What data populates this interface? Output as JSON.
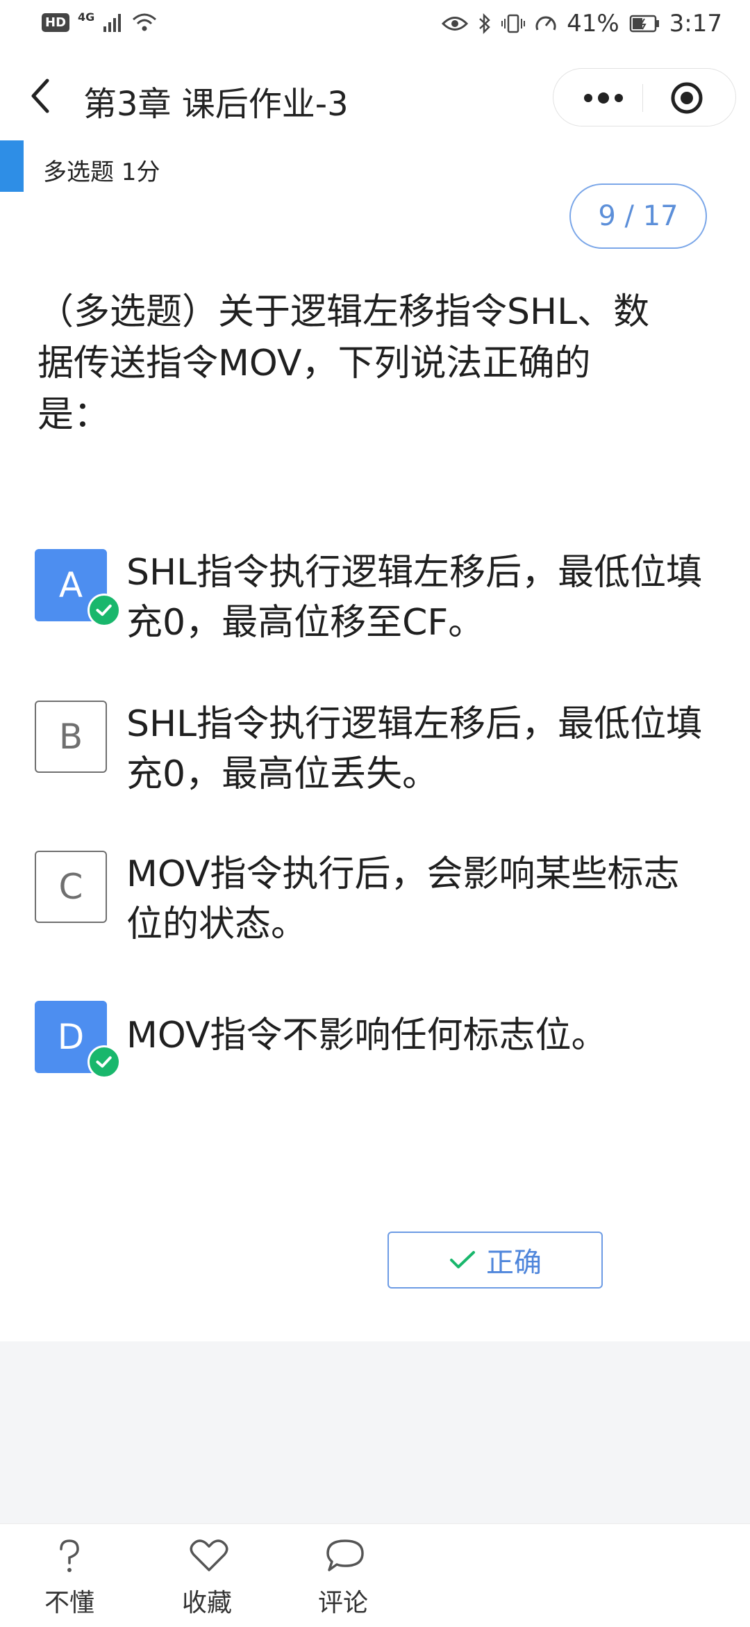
{
  "status_bar": {
    "hd": "HD",
    "network": "4G",
    "battery": "41%",
    "time": "3:17"
  },
  "nav": {
    "title": "第3章 课后作业-3"
  },
  "question": {
    "type_label": "多选题 1分",
    "progress": "9 / 17",
    "text": "（多选题）关于逻辑左移指令SHL、数据传送指令MOV，下列说法正确的是：",
    "options": [
      {
        "letter": "A",
        "text": "SHL指令执行逻辑左移后，最低位填充0，最高位移至CF。",
        "selected": true
      },
      {
        "letter": "B",
        "text": "SHL指令执行逻辑左移后，最低位填充0，最高位丢失。",
        "selected": false
      },
      {
        "letter": "C",
        "text": "MOV指令执行后，会影响某些标志位的状态。",
        "selected": false
      },
      {
        "letter": "D",
        "text": "MOV指令不影响任何标志位。",
        "selected": true
      }
    ]
  },
  "result": {
    "label": "正确"
  },
  "tabbar": {
    "items": [
      {
        "label": "不懂",
        "icon": "question-icon"
      },
      {
        "label": "收藏",
        "icon": "heart-icon"
      },
      {
        "label": "评论",
        "icon": "comment-icon"
      }
    ]
  },
  "colors": {
    "accent": "#2e8ee6",
    "selected": "#4d8ef0",
    "correct": "#19b76c",
    "result_text": "#4f86db"
  }
}
